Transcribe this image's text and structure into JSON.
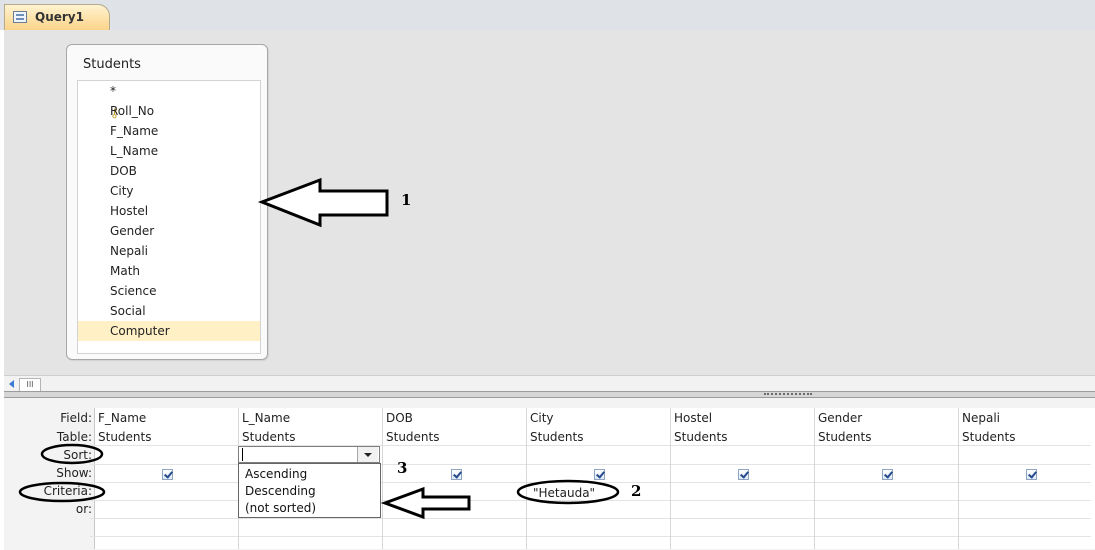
{
  "window": {
    "tab_title": "Query1",
    "tab_icon": "query-icon"
  },
  "field_list": {
    "title": "Students",
    "items": [
      {
        "label": "*",
        "key": false,
        "selected": false
      },
      {
        "label": "Roll_No",
        "key": true,
        "selected": false
      },
      {
        "label": "F_Name",
        "key": false,
        "selected": false
      },
      {
        "label": "L_Name",
        "key": false,
        "selected": false
      },
      {
        "label": "DOB",
        "key": false,
        "selected": false
      },
      {
        "label": "City",
        "key": false,
        "selected": false
      },
      {
        "label": "Hostel",
        "key": false,
        "selected": false
      },
      {
        "label": "Gender",
        "key": false,
        "selected": false
      },
      {
        "label": "Nepali",
        "key": false,
        "selected": false
      },
      {
        "label": "Math",
        "key": false,
        "selected": false
      },
      {
        "label": "Science",
        "key": false,
        "selected": false
      },
      {
        "label": "Social",
        "key": false,
        "selected": false
      },
      {
        "label": "Computer",
        "key": false,
        "selected": true
      }
    ]
  },
  "design_grid": {
    "row_labels": [
      "Field:",
      "Table:",
      "Sort:",
      "Show:",
      "Criteria:",
      "or:"
    ],
    "columns": [
      {
        "field": "F_Name",
        "table": "Students",
        "sort": "",
        "show": true,
        "criteria": ""
      },
      {
        "field": "L_Name",
        "table": "Students",
        "sort": "",
        "show": true,
        "criteria": ""
      },
      {
        "field": "DOB",
        "table": "Students",
        "sort": "",
        "show": true,
        "criteria": ""
      },
      {
        "field": "City",
        "table": "Students",
        "sort": "",
        "show": true,
        "criteria": "\"Hetauda\""
      },
      {
        "field": "Hostel",
        "table": "Students",
        "sort": "",
        "show": true,
        "criteria": ""
      },
      {
        "field": "Gender",
        "table": "Students",
        "sort": "",
        "show": true,
        "criteria": ""
      },
      {
        "field": "Nepali",
        "table": "Students",
        "sort": "",
        "show": true,
        "criteria": ""
      }
    ]
  },
  "sort_dropdown": {
    "options": [
      "Ascending",
      "Descending",
      "(not sorted)"
    ]
  },
  "annotations": {
    "label_1": "1",
    "label_2": "2",
    "label_3": "3"
  },
  "scrollbar": {
    "thumb_label": "III"
  },
  "colors": {
    "tab": "#fbd48a",
    "selected_field": "#fff0c6",
    "checkbox": "#25498c",
    "background": "#e4e4e4"
  }
}
